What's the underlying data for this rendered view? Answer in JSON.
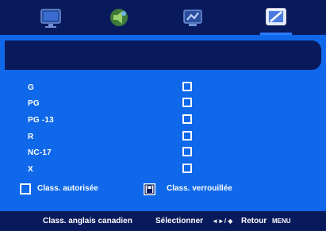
{
  "tabs": [
    {
      "icon": "picture-icon"
    },
    {
      "icon": "sound-icon"
    },
    {
      "icon": "setup-icon"
    },
    {
      "icon": "lock-menu-icon",
      "active": true
    }
  ],
  "ratings": [
    {
      "label": "G"
    },
    {
      "label": "PG"
    },
    {
      "label": "PG -13"
    },
    {
      "label": "R"
    },
    {
      "label": "NC-17"
    },
    {
      "label": "X"
    }
  ],
  "legend": {
    "allowed_label": "Class. autorisée",
    "locked_label": "Class. verrouillée"
  },
  "footer": {
    "title": "Class. anglais canadien",
    "select_label": "Sélectionner",
    "select_glyphs": "◄►/ ◆",
    "back_label": "Retour",
    "menu_key": "MENU"
  },
  "colors": {
    "background": "#0f68ea",
    "bars": "#081a5c",
    "text": "#ffffff"
  }
}
